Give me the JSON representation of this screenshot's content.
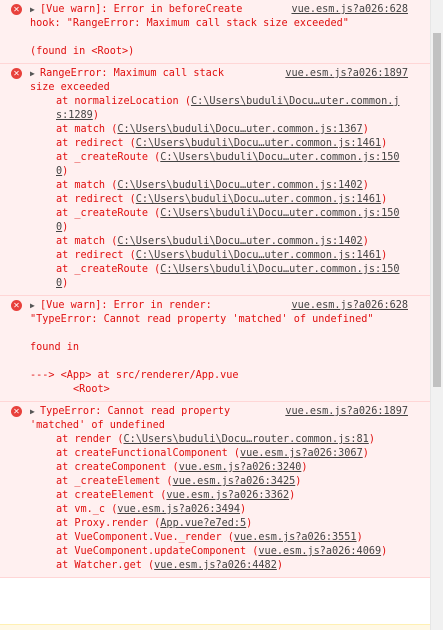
{
  "console": {
    "messages": [
      {
        "kind": "warn",
        "source": "vue.esm.js?a026:628",
        "lines": [
          "[Vue warn]: Error in beforeCreate",
          "hook: \"RangeError: Maximum call stack size exceeded\"",
          "",
          "(found in <Root>)"
        ]
      },
      {
        "kind": "error",
        "source": "vue.esm.js?a026:1897",
        "lines": [
          "RangeError: Maximum call stack",
          "size exceeded"
        ],
        "frames": [
          {
            "fn": "at normalizeLocation",
            "loc": "C:\\Users\\buduli\\Docu…uter.common.js:1289"
          },
          {
            "fn": "at match",
            "loc": "C:\\Users\\buduli\\Docu…uter.common.js:1367"
          },
          {
            "fn": "at redirect",
            "loc": "C:\\Users\\buduli\\Docu…uter.common.js:1461"
          },
          {
            "fn": "at _createRoute",
            "loc": "C:\\Users\\buduli\\Docu…uter.common.js:1500"
          },
          {
            "fn": "at match",
            "loc": "C:\\Users\\buduli\\Docu…uter.common.js:1402"
          },
          {
            "fn": "at redirect",
            "loc": "C:\\Users\\buduli\\Docu…uter.common.js:1461"
          },
          {
            "fn": "at _createRoute",
            "loc": "C:\\Users\\buduli\\Docu…uter.common.js:1500"
          },
          {
            "fn": "at match",
            "loc": "C:\\Users\\buduli\\Docu…uter.common.js:1402"
          },
          {
            "fn": "at redirect",
            "loc": "C:\\Users\\buduli\\Docu…uter.common.js:1461"
          },
          {
            "fn": "at _createRoute",
            "loc": "C:\\Users\\buduli\\Docu…uter.common.js:1500"
          }
        ]
      },
      {
        "kind": "warn",
        "source": "vue.esm.js?a026:628",
        "lines": [
          "[Vue warn]: Error in render:",
          "\"TypeError: Cannot read property 'matched' of undefined\"",
          "",
          "found in",
          "",
          "---> <App> at src/renderer/App.vue",
          "       <Root>"
        ]
      },
      {
        "kind": "error",
        "source": "vue.esm.js?a026:1897",
        "lines": [
          "TypeError: Cannot read property",
          "'matched' of undefined"
        ],
        "frames": [
          {
            "fn": "at render",
            "loc": "C:\\Users\\buduli\\Docu…router.common.js:81"
          },
          {
            "fn": "at createFunctionalComponent",
            "loc": "vue.esm.js?a026:3067"
          },
          {
            "fn": "at createComponent",
            "loc": "vue.esm.js?a026:3240"
          },
          {
            "fn": "at _createElement",
            "loc": "vue.esm.js?a026:3425"
          },
          {
            "fn": "at createElement",
            "loc": "vue.esm.js?a026:3362"
          },
          {
            "fn": "at vm._c",
            "loc": "vue.esm.js?a026:3494"
          },
          {
            "fn": "at Proxy.render",
            "loc": "App.vue?e7ed:5"
          },
          {
            "fn": "at VueComponent.Vue._render",
            "loc": "vue.esm.js?a026:3551"
          },
          {
            "fn": "at VueComponent.updateComponent",
            "loc": "vue.esm.js?a026:4069"
          },
          {
            "fn": "at Watcher.get",
            "loc": "vue.esm.js?a026:4482"
          }
        ]
      }
    ]
  },
  "icons": {
    "error": "error-circle-icon",
    "expand": "expand-triangle-icon"
  },
  "glyphs": {
    "error": "✕",
    "expand": "▶"
  },
  "colors": {
    "error_text": "#e01010",
    "error_bg": "#fff0f0",
    "link": "#444444"
  }
}
